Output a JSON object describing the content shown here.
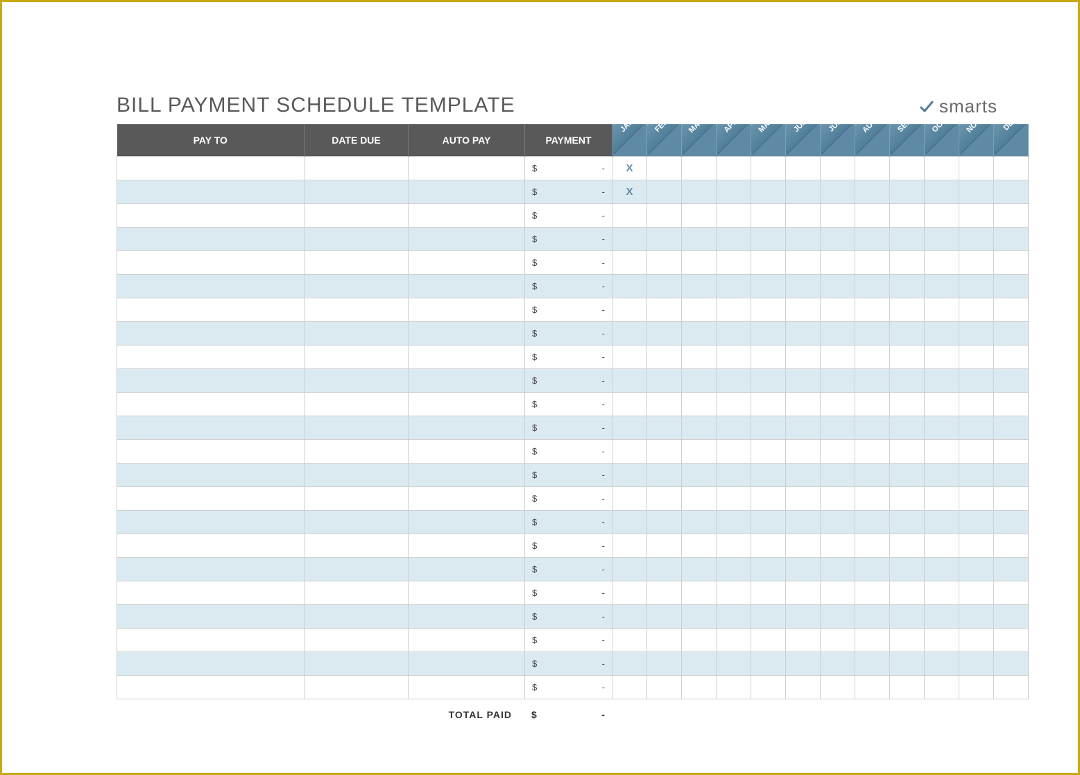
{
  "title": "BILL PAYMENT SCHEDULE TEMPLATE",
  "logo_text": "smarts",
  "columns": {
    "payto": "PAY TO",
    "datedue": "DATE DUE",
    "autopay": "AUTO PAY",
    "payment": "PAYMENT"
  },
  "months": [
    "JAN",
    "FEB",
    "MAR",
    "APR",
    "MAY",
    "JUN",
    "JUL",
    "AUG",
    "SEP",
    "OCT",
    "NOV",
    "DE"
  ],
  "currency_symbol": "$",
  "empty_value": "-",
  "rows": [
    {
      "payto": "",
      "datedue": "",
      "autopay": "",
      "payment": "-",
      "marks": {
        "JAN": "X"
      }
    },
    {
      "payto": "",
      "datedue": "",
      "autopay": "",
      "payment": "-",
      "marks": {
        "JAN": "X"
      }
    },
    {
      "payto": "",
      "datedue": "",
      "autopay": "",
      "payment": "-",
      "marks": {}
    },
    {
      "payto": "",
      "datedue": "",
      "autopay": "",
      "payment": "-",
      "marks": {}
    },
    {
      "payto": "",
      "datedue": "",
      "autopay": "",
      "payment": "-",
      "marks": {}
    },
    {
      "payto": "",
      "datedue": "",
      "autopay": "",
      "payment": "-",
      "marks": {}
    },
    {
      "payto": "",
      "datedue": "",
      "autopay": "",
      "payment": "-",
      "marks": {}
    },
    {
      "payto": "",
      "datedue": "",
      "autopay": "",
      "payment": "-",
      "marks": {}
    },
    {
      "payto": "",
      "datedue": "",
      "autopay": "",
      "payment": "-",
      "marks": {}
    },
    {
      "payto": "",
      "datedue": "",
      "autopay": "",
      "payment": "-",
      "marks": {}
    },
    {
      "payto": "",
      "datedue": "",
      "autopay": "",
      "payment": "-",
      "marks": {}
    },
    {
      "payto": "",
      "datedue": "",
      "autopay": "",
      "payment": "-",
      "marks": {}
    },
    {
      "payto": "",
      "datedue": "",
      "autopay": "",
      "payment": "-",
      "marks": {}
    },
    {
      "payto": "",
      "datedue": "",
      "autopay": "",
      "payment": "-",
      "marks": {}
    },
    {
      "payto": "",
      "datedue": "",
      "autopay": "",
      "payment": "-",
      "marks": {}
    },
    {
      "payto": "",
      "datedue": "",
      "autopay": "",
      "payment": "-",
      "marks": {}
    },
    {
      "payto": "",
      "datedue": "",
      "autopay": "",
      "payment": "-",
      "marks": {}
    },
    {
      "payto": "",
      "datedue": "",
      "autopay": "",
      "payment": "-",
      "marks": {}
    },
    {
      "payto": "",
      "datedue": "",
      "autopay": "",
      "payment": "-",
      "marks": {}
    },
    {
      "payto": "",
      "datedue": "",
      "autopay": "",
      "payment": "-",
      "marks": {}
    },
    {
      "payto": "",
      "datedue": "",
      "autopay": "",
      "payment": "-",
      "marks": {}
    },
    {
      "payto": "",
      "datedue": "",
      "autopay": "",
      "payment": "-",
      "marks": {}
    },
    {
      "payto": "",
      "datedue": "",
      "autopay": "",
      "payment": "-",
      "marks": {}
    }
  ],
  "total": {
    "label": "TOTAL PAID",
    "value": "-"
  }
}
